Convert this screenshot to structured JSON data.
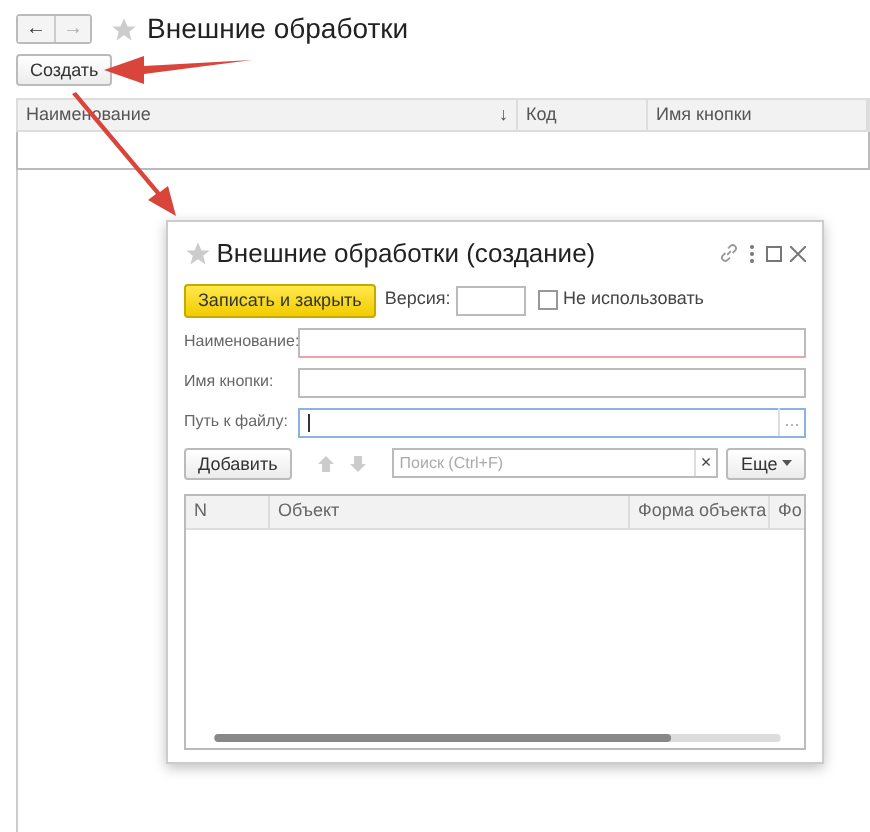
{
  "main_window": {
    "nav_buttons": [
      "←",
      "→"
    ],
    "title": "Внешние обработки",
    "create_button": "Создать",
    "columns": [
      {
        "label": "Наименование",
        "sort": "↓"
      },
      {
        "label": "Код"
      },
      {
        "label": "Имя кнопки"
      }
    ]
  },
  "dialog": {
    "title": "Внешние обработки (создание)",
    "save_button": "Записать и закрыть",
    "version_label": "Версия:",
    "disable_checkbox": {
      "label": "Не использовать",
      "checked": false
    },
    "fields": [
      {
        "label": "Наименование:",
        "required": true,
        "focused": false
      },
      {
        "label": "Имя кнопки:",
        "required": false,
        "focused": false
      },
      {
        "label": "Путь к файлу:",
        "required": false,
        "focused": true,
        "picker_button": "..."
      }
    ],
    "add_button": "Добавить",
    "search": {
      "placeholder": "Поиск (Ctrl+F)",
      "clear": "×"
    },
    "more_button": "Еще",
    "grid_columns": [
      "N",
      "Объект",
      "Форма объекта",
      "Фо"
    ]
  }
}
